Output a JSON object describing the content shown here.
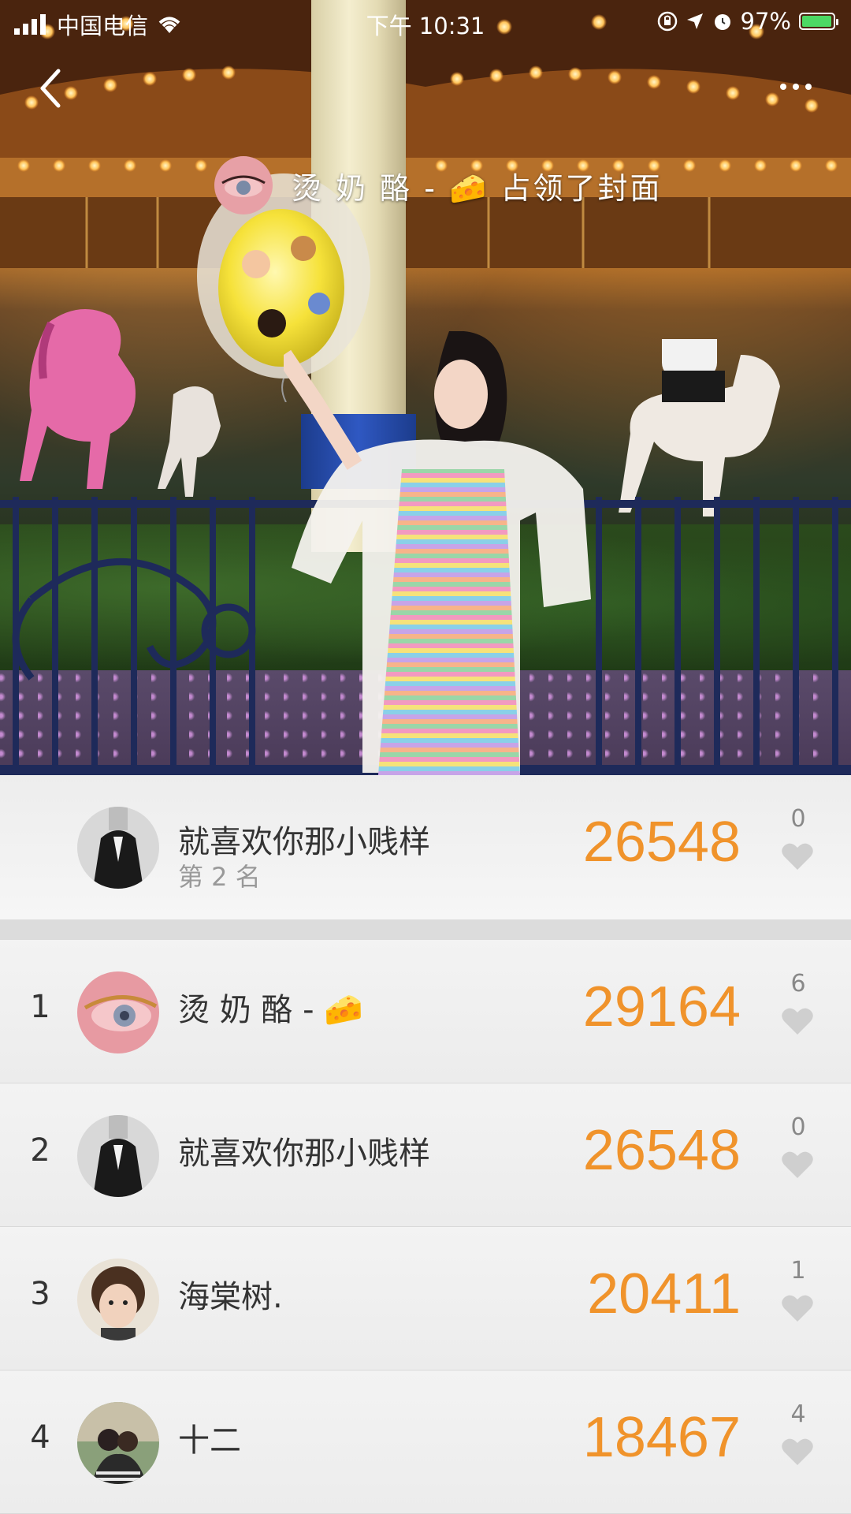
{
  "status_bar": {
    "carrier": "中国电信",
    "time": "下午 10:31",
    "battery": "97%",
    "battery_level": 0.97
  },
  "cover": {
    "owner_name": "烫 奶 酪 -",
    "owner_suffix": "占领了封面",
    "owner_emoji": "🧀"
  },
  "my_rank": {
    "name": "就喜欢你那小贱样",
    "subtitle": "第 2 名",
    "score": "26548",
    "likes": "0"
  },
  "ranking": [
    {
      "rank": "1",
      "name": "烫 奶 酪 -",
      "emoji": "🧀",
      "score": "29164",
      "likes": "6",
      "avatar": "eye"
    },
    {
      "rank": "2",
      "name": "就喜欢你那小贱样",
      "emoji": "",
      "score": "26548",
      "likes": "0",
      "avatar": "suit"
    },
    {
      "rank": "3",
      "name": "海棠树.",
      "emoji": "",
      "score": "20411",
      "likes": "1",
      "avatar": "kid"
    },
    {
      "rank": "4",
      "name": "十二",
      "emoji": "",
      "score": "18467",
      "likes": "4",
      "avatar": "couple"
    }
  ],
  "colors": {
    "score": "#f0932b",
    "like_icon": "#cfcfcf",
    "battery_fill": "#4cd964"
  },
  "icons": {
    "back": "back-chevron-icon",
    "more": "more-dots-icon",
    "like": "heart-icon",
    "signal": "signal-icon",
    "wifi": "wifi-icon",
    "lock": "rotation-lock-icon",
    "location": "location-arrow-icon",
    "alarm": "alarm-icon"
  }
}
